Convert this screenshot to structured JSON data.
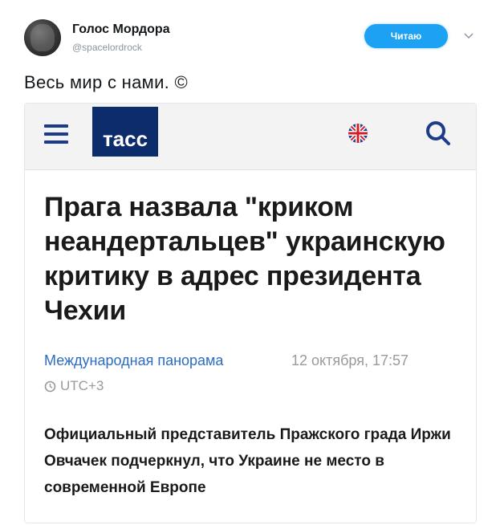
{
  "tweet": {
    "author_name": "Голос Мордора",
    "author_handle": "@spacelordrock",
    "follow_label": "Читаю",
    "text": "Весь мир с нами. ©"
  },
  "card": {
    "logo_text": "тасс",
    "headline": "Прага назвала \"криком неандертальцев\" украинскую критику в адрес президента Чехии",
    "category": "Международная панорама",
    "date": "12 октября, 17:57",
    "timezone": "UTC+3",
    "lead": "Официальный представитель Пражского града Иржи Овчачек подчеркнул, что Украине не место в современной Европе"
  },
  "colors": {
    "follow_button": "#1da1f2",
    "tass_blue": "#0d2c6c",
    "category_link": "#2b6cc4"
  },
  "icons": [
    "menu-icon",
    "uk-flag-icon",
    "search-icon",
    "clock-icon",
    "chevron-down-icon"
  ]
}
